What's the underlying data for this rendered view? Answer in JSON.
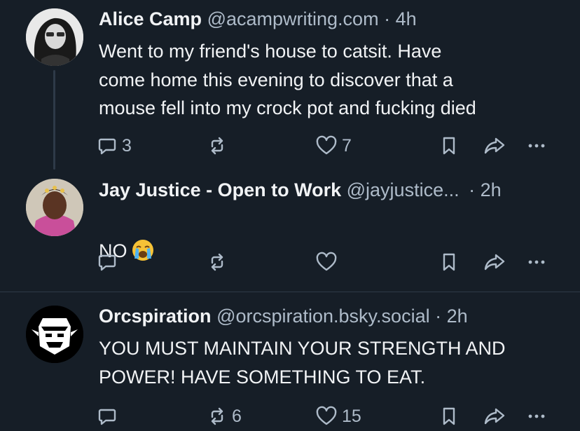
{
  "posts": [
    {
      "author": "Alice Camp",
      "handle": "@acampwriting.com",
      "separator": "·",
      "time": "4h",
      "text": "Went to my friend's house to catsit. Have\ncome home this evening to discover that a\nmouse fell into my crock pot and fucking died",
      "reply_count": "3",
      "repost_count": "",
      "like_count": "7"
    },
    {
      "author": "Jay Justice - Open to Work",
      "handle": "@jayjustice...",
      "separator": "·",
      "time": "2h",
      "text": "NO",
      "emoji": "crying-face",
      "reply_count": "",
      "repost_count": "",
      "like_count": ""
    },
    {
      "author": "Orcspiration",
      "handle": "@orcspiration.bsky.social",
      "separator": "·",
      "time": "2h",
      "text": "YOU MUST MAINTAIN YOUR STRENGTH AND\nPOWER! HAVE SOMETHING TO EAT.",
      "reply_count": "",
      "repost_count": "6",
      "like_count": "15"
    }
  ],
  "colors": {
    "background": "#161e27",
    "text": "#f1f3f5",
    "muted": "#aebbc9",
    "divider": "#2e3a48"
  }
}
